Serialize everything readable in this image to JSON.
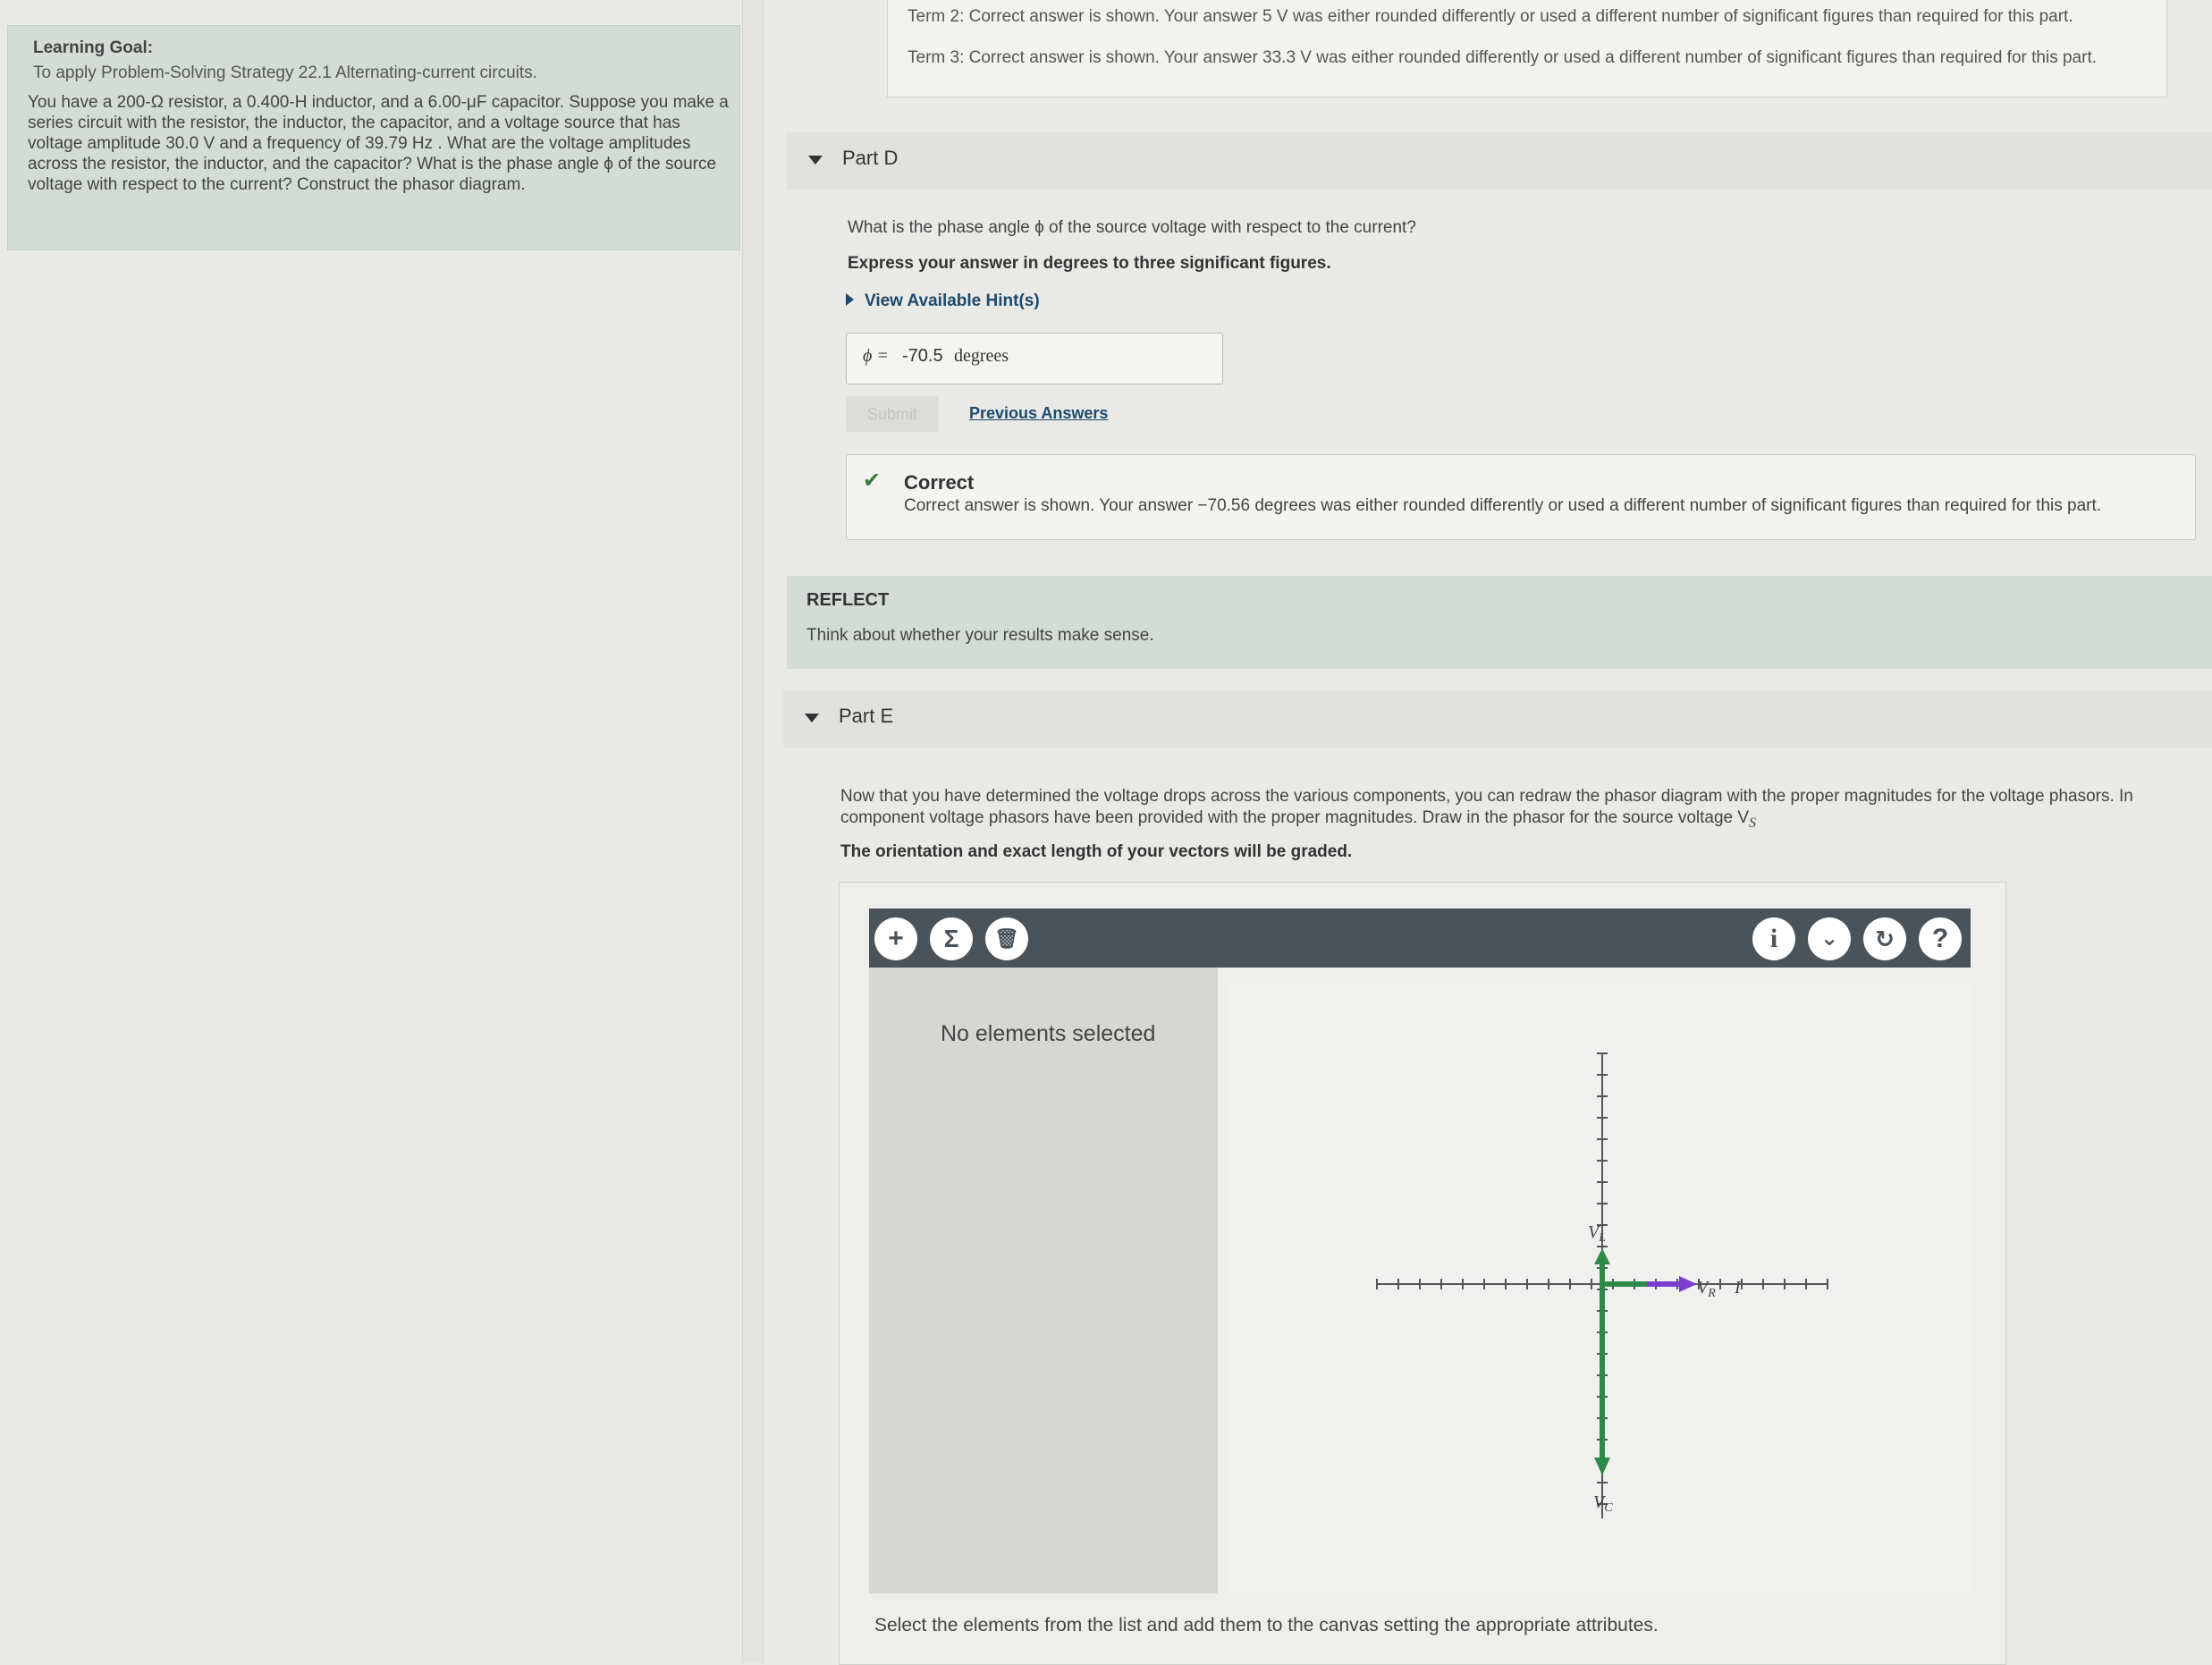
{
  "goal": {
    "heading": "Learning Goal:",
    "subheading": "To apply Problem-Solving Strategy 22.1 Alternating-current circuits.",
    "body": "You have a 200-Ω resistor, a 0.400-H inductor, and a 6.00-μF capacitor. Suppose you make a series circuit with the resistor, the inductor, the capacitor, and a voltage source that has voltage amplitude 30.0 V and a frequency of 39.79 Hz . What are the voltage amplitudes across the resistor, the inductor, and the capacitor? What is the phase angle ϕ of the source voltage with respect to the current? Construct the phasor diagram."
  },
  "prior_feedback": {
    "term2": "Term 2: Correct answer is shown. Your answer 5 V was either rounded differently or used a different number of significant figures than required for this part.",
    "term3": "Term 3: Correct answer is shown. Your answer 33.3 V was either rounded differently or used a different number of significant figures than required for this part."
  },
  "part_d": {
    "label": "Part D",
    "question": "What is the phase angle ϕ of the source voltage with respect to the current?",
    "instruction": "Express your answer in degrees to three significant figures.",
    "hint_link": "View Available Hint(s)",
    "answer_symbol": "ϕ =",
    "answer_value": "-70.5",
    "answer_unit": "degrees",
    "submit_label": "Submit",
    "previous_answers_label": "Previous Answers",
    "feedback_title": "Correct",
    "feedback_text": "Correct answer is shown. Your answer −70.56 degrees was either rounded differently or used a different number of significant figures than required for this part."
  },
  "reflect": {
    "title": "REFLECT",
    "text": "Think about whether your results make sense."
  },
  "part_e": {
    "label": "Part E",
    "question_line1": "Now that you have determined the voltage drops across the various components, you can redraw the phasor diagram with the proper magnitudes for the voltage phasors. In",
    "question_line2": "component voltage phasors have been provided with the proper magnitudes. Draw in the phasor for the source voltage V",
    "question_sub": "S",
    "instruction": "The orientation and exact length of your vectors will be graded."
  },
  "tool": {
    "buttons_left": [
      "+",
      "Σ",
      "🗑"
    ],
    "buttons_right": [
      "i",
      "⌄",
      "↻",
      "?"
    ],
    "panel_text": "No elements selected",
    "footer": "Select the elements from the list and add them to the canvas setting the appropriate attributes.",
    "phasor_labels": {
      "vl": "V",
      "vl_sub": "L",
      "vr": "V",
      "vr_sub": "R",
      "vc": "V",
      "vc_sub": "C",
      "i": "I"
    },
    "colors": {
      "vl_vc": "#2e8a48",
      "vr": "#7a3fd0",
      "axis": "#555555"
    }
  }
}
